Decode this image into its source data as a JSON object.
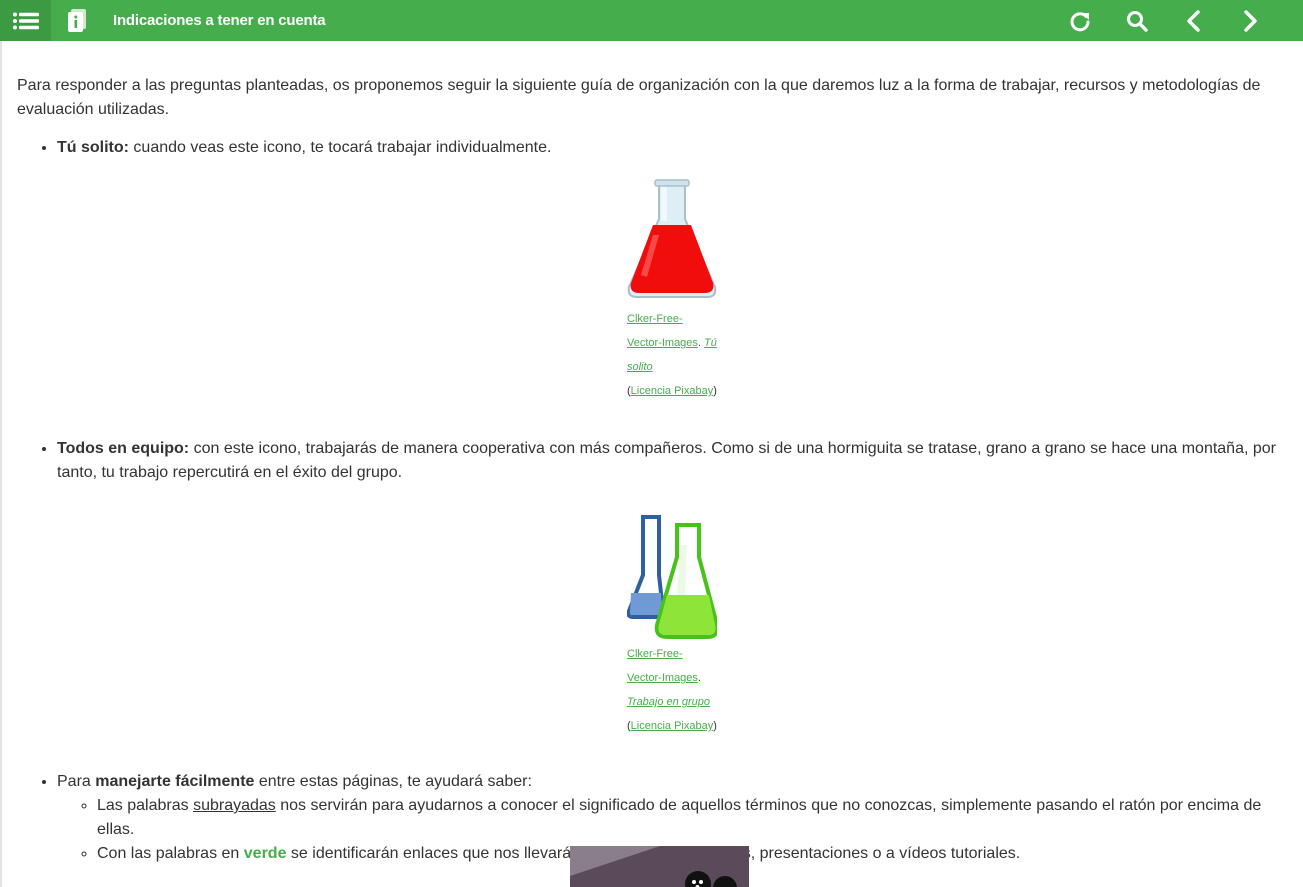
{
  "header": {
    "title": "Indicaciones a tener en cuenta",
    "menu_icon": "list-icon",
    "page_icon": "document-info-icon",
    "reload_icon": "reload-icon",
    "search_icon": "search-icon",
    "prev_icon": "chevron-left-icon",
    "next_icon": "chevron-right-icon",
    "bar_color": "#46ad4c"
  },
  "intro": "Para responder a las preguntas planteadas, os proponemos seguir la siguiente guía de organización con la que daremos luz a la forma de trabajar, recursos y metodologías de evaluación utilizadas.",
  "items": [
    {
      "bold": "Tú solito:",
      "text": " cuando veas este icono, te tocará trabajar individualmente.",
      "figure": {
        "author": "Clker-Free-Vector-Images",
        "sep": ". ",
        "title": "Tú solito",
        "license_open": "(",
        "license": "Licencia Pixabay",
        "license_close": ")"
      }
    },
    {
      "bold": "Todos en equipo:",
      "text": " con este icono, trabajarás de manera cooperativa con más compañeros. Como si de una hormiguita se tratase, grano a grano se hace una montaña, por tanto, tu trabajo repercutirá en el éxito del grupo.",
      "figure": {
        "author": "Clker-Free-Vector-Images",
        "sep": ". ",
        "title": "Trabajo en grupo",
        "license_open": "(",
        "license": "Licencia Pixabay",
        "license_close": ")"
      }
    },
    {
      "pre": "Para ",
      "bold": "manejarte fácilmente",
      "text": " entre estas páginas, te ayudará saber:",
      "subitems": [
        {
          "pre": "Las palabras ",
          "underlined": "subrayadas",
          "post": " nos servirán para ayudarnos a conocer el significado de aquellos términos que no conozcas, simplemente pasando el ratón por encima de ellas."
        },
        {
          "pre": "Con las palabras en ",
          "green": "verde",
          "post": " se identificarán enlaces que nos llevarán a rúbricas, documentos, presentaciones o a vídeos tutoriales."
        }
      ]
    }
  ]
}
